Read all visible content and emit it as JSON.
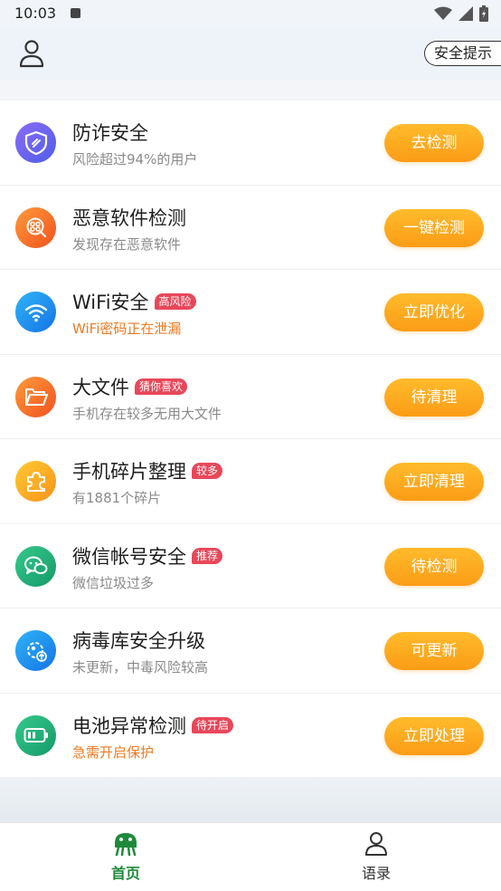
{
  "status_bar": {
    "time": "10:03"
  },
  "header": {
    "tip_label": "安全提示"
  },
  "items": [
    {
      "title": "防诈安全",
      "badge": "",
      "subtitle": "风险超过94%的用户",
      "subtitle_style": "normal",
      "action": "去检测",
      "icon": "shield-icon",
      "icon_color": "#6c5ce7"
    },
    {
      "title": "恶意软件检测",
      "badge": "",
      "subtitle": "发现存在恶意软件",
      "subtitle_style": "normal",
      "action": "一键检测",
      "icon": "virus-scan-icon",
      "icon_color": "#f5731f"
    },
    {
      "title": "WiFi安全",
      "badge": "高风险",
      "subtitle": "WiFi密码正在泄漏",
      "subtitle_style": "warn",
      "action": "立即优化",
      "icon": "wifi-icon",
      "icon_color": "#1d8ff0"
    },
    {
      "title": "大文件",
      "badge": "猜你喜欢",
      "subtitle": "手机存在较多无用大文件",
      "subtitle_style": "normal",
      "action": "待清理",
      "icon": "folder-icon",
      "icon_color": "#f7761a"
    },
    {
      "title": "手机碎片整理",
      "badge": "较多",
      "subtitle": "有1881个碎片",
      "subtitle_style": "normal",
      "action": "立即清理",
      "icon": "puzzle-icon",
      "icon_color": "#f9a71a"
    },
    {
      "title": "微信帐号安全",
      "badge": "推荐",
      "subtitle": "微信垃圾过多",
      "subtitle_style": "normal",
      "action": "待检测",
      "icon": "wechat-icon",
      "icon_color": "#23b07a"
    },
    {
      "title": "病毒库安全升级",
      "badge": "",
      "subtitle": "未更新，中毒风险较高",
      "subtitle_style": "normal",
      "action": "可更新",
      "icon": "virus-update-icon",
      "icon_color": "#1d8ff0"
    },
    {
      "title": "电池异常检测",
      "badge": "待开启",
      "subtitle": "急需开启保护",
      "subtitle_style": "warn",
      "action": "立即处理",
      "icon": "battery-icon",
      "icon_color": "#23b07a"
    }
  ],
  "tabs": [
    {
      "label": "首页",
      "active": true,
      "icon": "home-robot-icon"
    },
    {
      "label": "语录",
      "active": false,
      "icon": "person-icon"
    }
  ],
  "colors": {
    "accent_orange": "#fb9c16",
    "badge_red": "#e8475a",
    "warn_text": "#ee7a22",
    "tab_active": "#1e8a3a"
  }
}
